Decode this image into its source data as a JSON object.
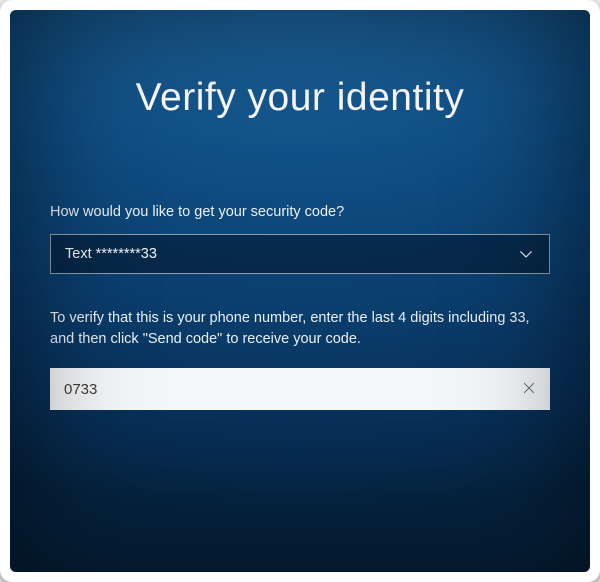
{
  "title": "Verify your identity",
  "prompt": "How would you like to get your security code?",
  "method_select": {
    "selected": "Text ********33"
  },
  "instructions": "To verify that this is your phone number, enter the last 4 digits including 33, and then click \"Send code\" to receive your code.",
  "phone_input": {
    "value": "0733",
    "placeholder": ""
  },
  "icons": {
    "chevron_down": "chevron-down-icon",
    "clear": "close-icon"
  }
}
